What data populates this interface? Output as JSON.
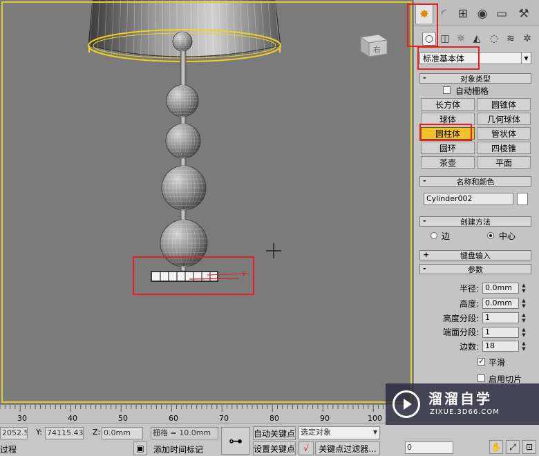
{
  "panel": {
    "tabs": [
      {
        "name": "create",
        "icon": "sun-star-icon"
      },
      {
        "name": "modify",
        "icon": "curve-icon"
      },
      {
        "name": "hierarchy",
        "icon": "hierarchy-icon"
      },
      {
        "name": "motion",
        "icon": "motion-icon"
      },
      {
        "name": "display",
        "icon": "monitor-icon"
      },
      {
        "name": "utilities",
        "icon": "hammer-icon"
      }
    ],
    "subcategory_icons": [
      "geometry-icon",
      "shapes-icon",
      "lights-icon",
      "cameras-icon",
      "helpers-icon",
      "spacewarps-icon",
      "systems-icon"
    ],
    "dropdown_value": "标准基本体",
    "object_type": {
      "title": "对象类型",
      "autogrid_label": "自动栅格",
      "buttons": [
        "长方体",
        "圆锥体",
        "球体",
        "几何球体",
        "圆柱体",
        "管状体",
        "圆环",
        "四棱锥",
        "茶壶",
        "平面"
      ],
      "active_button": "圆柱体"
    },
    "name_color": {
      "title": "名称和颜色",
      "object_name": "Cylinder002",
      "color": "#ffffff"
    },
    "creation_method": {
      "title": "创建方法",
      "option_edge": "边",
      "option_center": "中心",
      "selected": "中心"
    },
    "keyboard_entry": {
      "title": "键盘输入",
      "sign": "+"
    },
    "parameters": {
      "title": "参数",
      "radius_label": "半径:",
      "radius_value": "0.0mm",
      "height_label": "高度:",
      "height_value": "0.0mm",
      "height_segments_label": "高度分段:",
      "height_segments_value": "1",
      "cap_segments_label": "端面分段:",
      "cap_segments_value": "1",
      "sides_label": "边数:",
      "sides_value": "18",
      "smooth_label": "平滑",
      "smooth_checked": true,
      "slice_label": "启用切片",
      "slice_checked": false
    }
  },
  "viewport": {
    "viewcube_label": "右",
    "axis_label": "y",
    "border_color": "#e0d02a",
    "highlight_color": "#e62020"
  },
  "timeline": {
    "ticks": [
      "30",
      "40",
      "50",
      "60",
      "70",
      "80",
      "90",
      "100"
    ]
  },
  "status": {
    "x_value": "2052.5",
    "y_label": "Y:",
    "y_value": "74115.43m",
    "z_label": "Z:",
    "z_value": "0.0mm",
    "grid_text": "栅格 = 10.0mm",
    "add_time_tag": "添加时间标记",
    "auto_key": "自动关键点",
    "set_key": "设置关键点",
    "selected_object": "选定对象",
    "key_filters": "关键点过滤器...",
    "left_text": "过程",
    "frame_value": "0"
  },
  "watermark": {
    "title": "溜溜自学",
    "url": "ZIXUE.3D66.COM"
  }
}
